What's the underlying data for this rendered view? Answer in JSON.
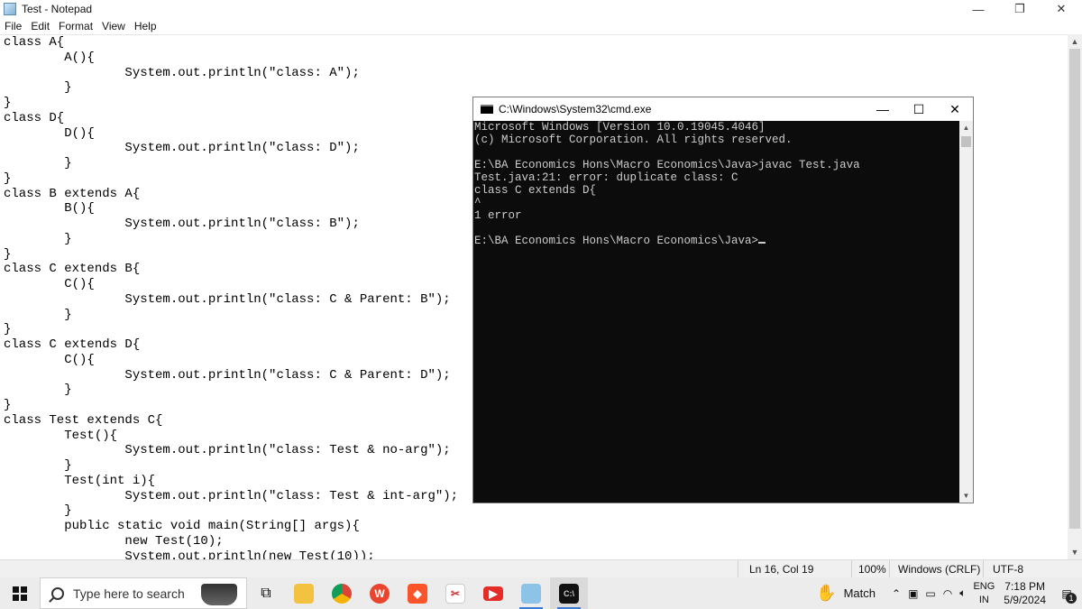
{
  "notepad": {
    "title": "Test - Notepad",
    "menu": [
      "File",
      "Edit",
      "Format",
      "View",
      "Help"
    ],
    "controls": {
      "minimize": "—",
      "restore": "❐",
      "close": "✕"
    },
    "content": "class A{\n        A(){\n                System.out.println(\"class: A\");\n        }\n}\nclass D{\n        D(){\n                System.out.println(\"class: D\");\n        }\n}\nclass B extends A{\n        B(){\n                System.out.println(\"class: B\");\n        }\n}\nclass C extends B{\n        C(){\n                System.out.println(\"class: C & Parent: B\");\n        }\n}\nclass C extends D{\n        C(){\n                System.out.println(\"class: C & Parent: D\");\n        }\n}\nclass Test extends C{\n        Test(){\n                System.out.println(\"class: Test & no-arg\");\n        }\n        Test(int i){\n                System.out.println(\"class: Test & int-arg\");\n        }\n        public static void main(String[] args){\n                new Test(10);\n                System.out.println(new Test(10));",
    "status": {
      "position": "Ln 16, Col 19",
      "zoom": "100%",
      "line_ending": "Windows (CRLF)",
      "encoding": "UTF-8"
    }
  },
  "cmd": {
    "title": "C:\\Windows\\System32\\cmd.exe",
    "controls": {
      "minimize": "—",
      "maximize": "☐",
      "close": "✕"
    },
    "output": "Microsoft Windows [Version 10.0.19045.4046]\n(c) Microsoft Corporation. All rights reserved.\n\nE:\\BA Economics Hons\\Macro Economics\\Java>javac Test.java\nTest.java:21: error: duplicate class: C\nclass C extends D{\n^\n1 error\n\nE:\\BA Economics Hons\\Macro Economics\\Java>"
  },
  "taskbar": {
    "search_placeholder": "Type here to search",
    "weather": "Match",
    "lang_top": "ENG",
    "lang_bottom": "IN",
    "time": "7:18 PM",
    "date": "5/9/2024",
    "notification_count": "1"
  }
}
